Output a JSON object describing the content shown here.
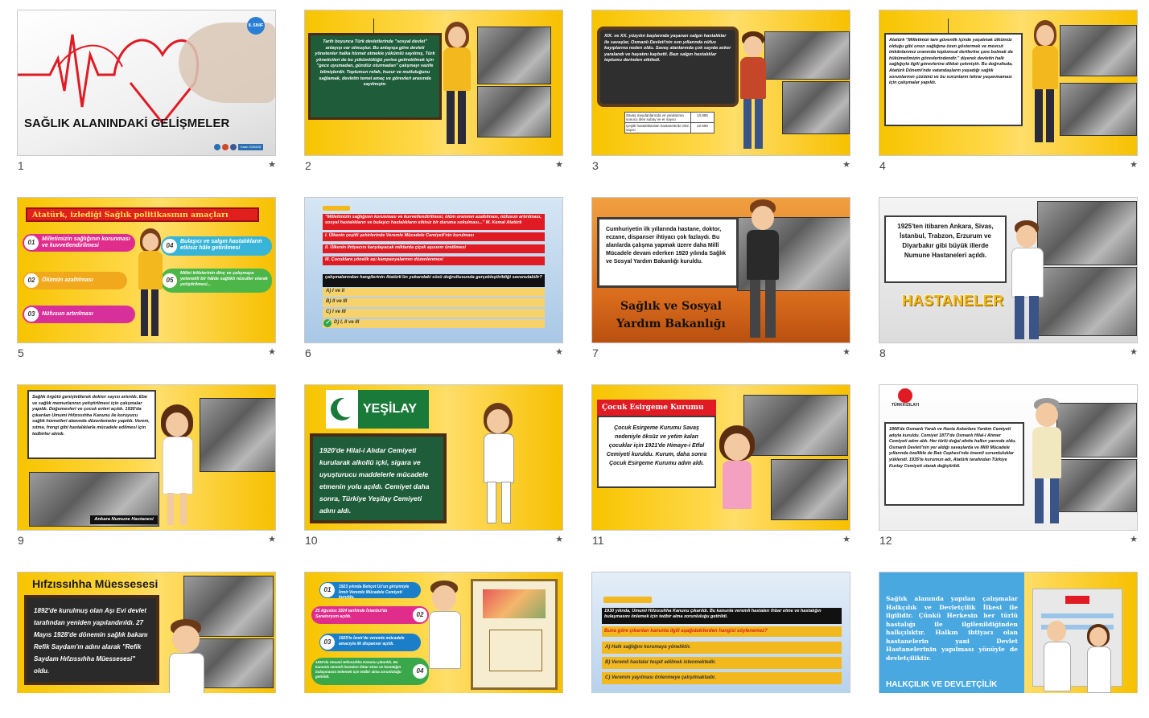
{
  "slides": [
    {
      "num": "1",
      "star": "★",
      "title": "SAĞLIK ALANINDAKİ GELİŞMELER",
      "badge": "8. SINIF",
      "footer": "Kaan GÜMÜŞ"
    },
    {
      "num": "2",
      "star": "★",
      "text": "Tarih boyunca Türk devletlerinde \"sosyal devlet\" anlayışı var olmuştur. Bu anlayışa göre devleti yönetenler halka hizmet etmekle yükümlü sayılmış, Türk yöneticileri de bu yükümlülüğü yerine getirebilmek için \"gece uyumadan, gündüz oturmadan\" çalışmayı vazife bilmişlerdir. Toplumun refah, huzur ve mutluluğunu sağlamak, devletin temel amaç ve görevleri arasında sayılmıştır."
    },
    {
      "num": "3",
      "star": "★",
      "text": "XIX. ve XX. yüzyılın başlarında yaşanan salgın hastalıklar ile savaşlar, Osmanlı Devleti'nin son yıllarında nüfus kayıplarına neden oldu. Savaş alanlarında çok sayıda asker yaralandı ve hayatını kaybetti. Bazı salgın hastalıklar toplumu derinden etkiledi.",
      "table": [
        [
          "Savaş meydanlarında ve yaralanma sonucu ölen subay ve er sayısı",
          "10.885"
        ],
        [
          "Çeşitli hastalıklardan hastanelerde ölen sayısı",
          "22.690"
        ]
      ]
    },
    {
      "num": "4",
      "star": "★",
      "text": "Atatürk \"Milletimizi tam güvenlik içinde yaşatmak ülkümüz olduğu gibi onun sağlığına özen göstermek ve mevcut imkânlarımız oranında toplumsal dertlerine çare bulmak da hükümetimizin görevlerindendir.\" diyerek devletin halk sağlığıyla ilgili görevlerine dikkat çekmiştir. Bu doğrultuda, Atatürk Dönemi'nde vatandaşların yaşadığı sağlık sorunlarının çözümü ve bu sorunların tekrar yaşanmaması için çalışmalar yapıldı."
    },
    {
      "num": "5",
      "star": "★",
      "title": "Atatürk, izlediği Sağlık politikasının amaçları",
      "items": [
        {
          "n": "01",
          "t": "Milletimizin sağlığının korunması ve kuvvetlendirilmesi"
        },
        {
          "n": "02",
          "t": "Ölümün azaltılması"
        },
        {
          "n": "03",
          "t": "Nüfusun artırılması"
        },
        {
          "n": "04",
          "t": "Bulaşıcı ve salgın hastalıkların etkisiz hâle getirilmesi"
        },
        {
          "n": "05",
          "t": "Millet kitlelerinin dinç ve çalışmaya yetenekli bir hâlde sağlıklı nüsuller olarak yetiştirilmesi..."
        }
      ]
    },
    {
      "num": "6",
      "star": "★",
      "q": "\"Milletimizin sağlığının korunması ve kuvvetlendirilmesi, ölüm oranının azaltılması, nüfusun artırılması, sosyal hastalıkların ve bulaşıcı hastalıkların etkisiz bir duruma sokulması...\" M. Kemal Atatürk",
      "items": [
        "I. Ülkenin çeşitli şehirlerinde Veremle Mücadele Cemiyeti'nin kurulması",
        "II. Ülkenin ihtiyacını karşılayacak miktarda çiçek aşısının üretilmesi",
        "III. Çocuklara yönelik aşı kampanyalarının düzenlenmesi"
      ],
      "prompt": "çalışmalarından hangilerinin Atatürk'ün yukarıdaki sözü doğrultusunda gerçekleştirildiği savunulabilir?",
      "options": [
        "A) I ve II",
        "B) II ve III",
        "C) I ve III",
        "D) I, II ve III"
      ]
    },
    {
      "num": "7",
      "star": "★",
      "text": "Cumhuriyetin ilk yıllarında hastane, doktor, eczane, dispanser ihtiyacı çok fazlaydı. Bu alanlarda çalışma yapmak üzere daha Millî Mücadele devam ederken 1920 yılında Sağlık ve Sosyal Yardım Bakanlığı kuruldu.",
      "title": "Sağlık ve Sosyal Yardım Bakanlığı"
    },
    {
      "num": "8",
      "star": "★",
      "text": "1925'ten itibaren Ankara, Sivas, İstanbul, Trabzon, Erzurum ve Diyarbakır gibi büyük illerde Numune Hastaneleri açıldı.",
      "title": "HASTANELER"
    },
    {
      "num": "9",
      "star": "★",
      "text": "Sağlık örgütü genişletilerek doktor sayısı artırıldı. Ebe ve sağlık memurlarının yetiştirilmesi için çalışmalar yapıldı. Doğumevleri ve çocuk evleri açıldı. 1930'da çıkarılan Umumi Hıfzıssıhha Kanunu ile koruyucu sağlık hizmetleri alanında düzenlemeler yapıldı. Verem, sıtma, frengi gibi hastalıklarla mücadele edilmesi için tedbirler alındı.",
      "caption": "Ankara Numune Hastanesi"
    },
    {
      "num": "10",
      "star": "★",
      "logo": "YEŞİLAY",
      "text": "1920'de Hilal-i Alıdar Cemiyeti kurularak alkollü içki, sigara ve uyuşturucu maddelerle mücadele etmenin yolu açıldı. Cemiyet daha sonra, Türkiye Yeşilay Cemiyeti adını aldı."
    },
    {
      "num": "11",
      "star": "★",
      "title": "Çocuk Esirgeme Kurumu",
      "text": "Çocuk Esirgeme Kurumu Savaş nedeniyle öksüz ve yetim kalan çocuklar için 1921'de Himaye-i Etfal Cemiyeti kuruldu. Kurum, daha sonra Çocuk Esirgeme Kurumu adım aldı."
    },
    {
      "num": "12",
      "star": "★",
      "logo": "TÜRKKIZILAYI",
      "text": "1868'de Osmanlı Yaralı ve Hasta Askerlara Yardım Cemiyeti adıyla kuruldu. Cemiyet 1877'de Osmanlı Hilal-i Ahmer Cemiyeti adım aldı. Her türlü doğal afette halkın yanında oldu. Osmanlı Devleti'nin yer aldığı savaşlarda ve Millî Mücadele yıllarında özellikle de Batı Cephesi'nde önemli sorumluluklar yüklendi. 1935'te kurumun adı, Atatürk tarafından Türkiye Kızılay Cemiyeti olarak değiştirildi."
    },
    {
      "num": "13",
      "star": "★",
      "title": "Hıfzıssıhha Müessesesi",
      "text": "1892'de kurulmuş olan Aşı Evi devlet tarafından yeniden yapılandırıldı. 27 Mayıs 1928'de dönemin sağlık bakanı Refik Saydam'ın adını alarak \"Refik Saydam Hıfzıssıhha Müessesesi\" oldu."
    },
    {
      "num": "14",
      "star": "★",
      "items": [
        {
          "n": "01",
          "t": "1923 yılında Behçet Uz'un girişimiyle İzmir Veremle Mücadele Cemiyeti kuruldu."
        },
        {
          "n": "02",
          "t": "25 Ağustos 1924 tarihinde İstanbul'da Sanatoryum açıldı."
        },
        {
          "n": "03",
          "t": "1925'te İzmir'de veremle mücadele amacıyla ilk dispanser açıldı."
        },
        {
          "n": "04",
          "t": "1930'da Umumi Hıfzıssıhha Kanunu çıkarıldı. Bu kanunla veremli hastaları ihbar etme ve hastalığın bulaşmasını önlemek için tedbir alma zorunluluğu getirildi."
        }
      ]
    },
    {
      "num": "15",
      "star": "★",
      "q": "1930 yılında, Umumi Hıfzıssıhha Kanunu çıkarıldı. Bu kanunla veremli hastaları ihbar etme ve hastalığın bulaşmasını önlemek için tedbir alma zorunluluğu getirildi.",
      "prompt": "Buna göre çıkarılan kanunla ilgili aşağıdakilerden hangisi söylenemez?",
      "options": [
        "A) Halk sağlığını korumaya yöneliktir.",
        "B) Veremli hastalar tespit edilmek istenmektedir.",
        "C) Veremin yayılması önlenmeye çalışılmaktadır."
      ]
    },
    {
      "num": "16",
      "star": "★",
      "text": "Sağlık alanında yapılan çalışmalar Halkçılık ve Devletçilik İlkesi ile ilgilidir. Çünkü Herkesin her türlü hastalığı ile ilgilenildiğinden halkçılıktır. Halkın ihtiyacı olan hastanelerin yani Devlet Hastanelerinin yapılması yönüyle de devletçiliktir.",
      "title": "HALKÇILIK VE DEVLETÇİLİK"
    }
  ]
}
